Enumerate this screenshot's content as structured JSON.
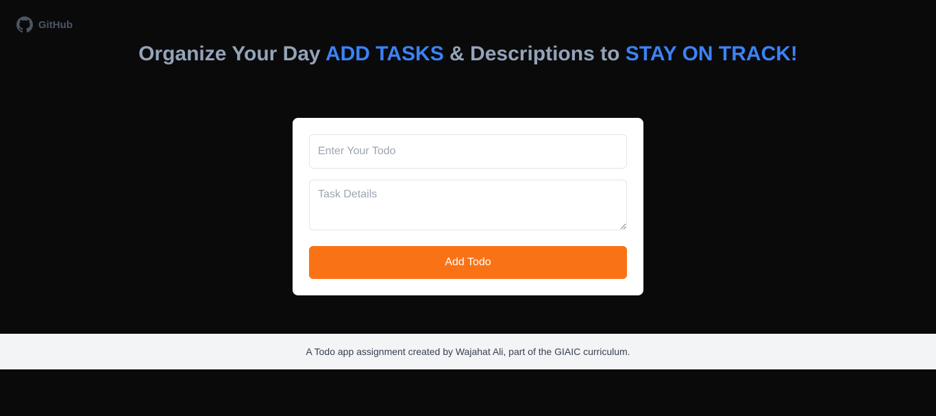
{
  "github": {
    "label": "GitHub",
    "icon": "github-icon"
  },
  "headline": {
    "part1": "Organize Your Day ",
    "accent1": "ADD TASKS",
    "part2": " & Descriptions to ",
    "accent2": "STAY ON TRACK!"
  },
  "form": {
    "todo_placeholder": "Enter Your Todo",
    "todo_value": "",
    "details_placeholder": "Task Details",
    "details_value": "",
    "add_button_label": "Add Todo"
  },
  "footer": {
    "text": "A Todo app assignment created by Wajahat Ali, part of the GIAIC curriculum."
  },
  "colors": {
    "background": "#0a0a0b",
    "headline_muted": "#94a3b8",
    "accent": "#3b82f6",
    "button": "#f97316",
    "footer_background": "#f3f4f6"
  }
}
